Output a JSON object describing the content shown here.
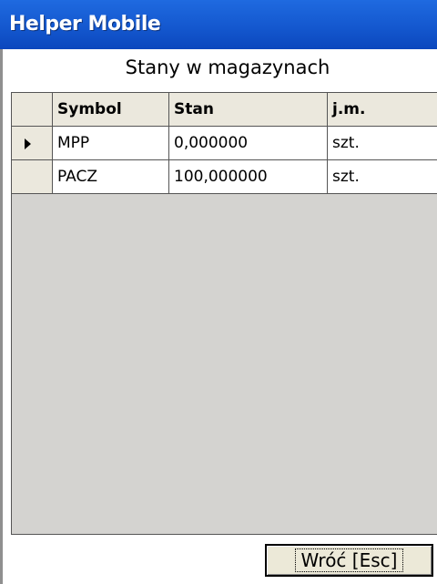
{
  "window": {
    "title": "Helper Mobile"
  },
  "heading": "Stany w magazynach",
  "table": {
    "columns": [
      "Symbol",
      "Stan",
      "j.m."
    ],
    "rows": [
      {
        "symbol": "MPP",
        "stan": "0,000000",
        "jm": "szt.",
        "selected": true
      },
      {
        "symbol": "PACZ",
        "stan": "100,000000",
        "jm": "szt.",
        "selected": false
      }
    ]
  },
  "buttons": {
    "back_label": "Wróć [Esc]"
  },
  "colors": {
    "titlebar": "#1458cf",
    "grid_background": "#d4d3d0",
    "header_background": "#ebe8dd"
  }
}
